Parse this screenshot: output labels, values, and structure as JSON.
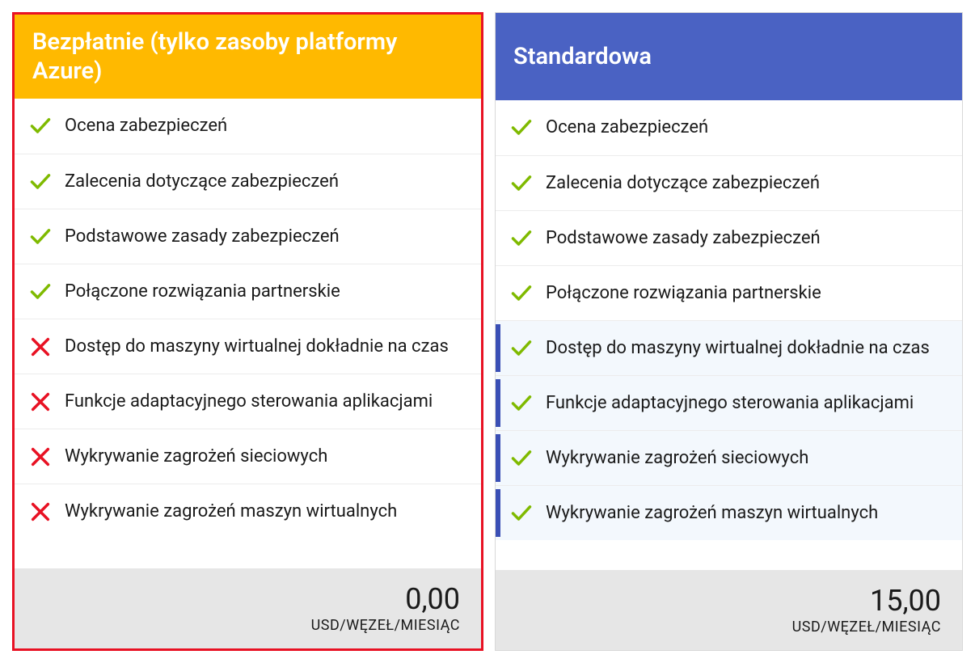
{
  "plans": [
    {
      "id": "free",
      "title": "Bezpłatnie (tylko zasoby platformy Azure)",
      "header_color": "yellow",
      "selected": true,
      "price": "0,00",
      "price_unit": "USD/WĘZEŁ/MIESIĄC",
      "features": [
        {
          "label": "Ocena zabezpieczeń",
          "has": true,
          "highlight": false
        },
        {
          "label": "Zalecenia dotyczące zabezpieczeń",
          "has": true,
          "highlight": false
        },
        {
          "label": "Podstawowe zasady zabezpieczeń",
          "has": true,
          "highlight": false
        },
        {
          "label": "Połączone rozwiązania partnerskie",
          "has": true,
          "highlight": false
        },
        {
          "label": "Dostęp do maszyny wirtualnej dokładnie na czas",
          "has": false,
          "highlight": false
        },
        {
          "label": "Funkcje adaptacyjnego sterowania aplikacjami",
          "has": false,
          "highlight": false
        },
        {
          "label": "Wykrywanie zagrożeń sieciowych",
          "has": false,
          "highlight": false
        },
        {
          "label": "Wykrywanie zagrożeń maszyn wirtualnych",
          "has": false,
          "highlight": false
        }
      ]
    },
    {
      "id": "standard",
      "title": "Standardowa",
      "header_color": "blue",
      "selected": false,
      "price": "15,00",
      "price_unit": "USD/WĘZEŁ/MIESIĄC",
      "features": [
        {
          "label": "Ocena zabezpieczeń",
          "has": true,
          "highlight": false
        },
        {
          "label": "Zalecenia dotyczące zabezpieczeń",
          "has": true,
          "highlight": false
        },
        {
          "label": "Podstawowe zasady zabezpieczeń",
          "has": true,
          "highlight": false
        },
        {
          "label": "Połączone rozwiązania partnerskie",
          "has": true,
          "highlight": false
        },
        {
          "label": "Dostęp do maszyny wirtualnej dokładnie na czas",
          "has": true,
          "highlight": true
        },
        {
          "label": "Funkcje adaptacyjnego sterowania aplikacjami",
          "has": true,
          "highlight": true
        },
        {
          "label": "Wykrywanie zagrożeń sieciowych",
          "has": true,
          "highlight": true
        },
        {
          "label": "Wykrywanie zagrożeń maszyn wirtualnych",
          "has": true,
          "highlight": true
        }
      ]
    }
  ]
}
